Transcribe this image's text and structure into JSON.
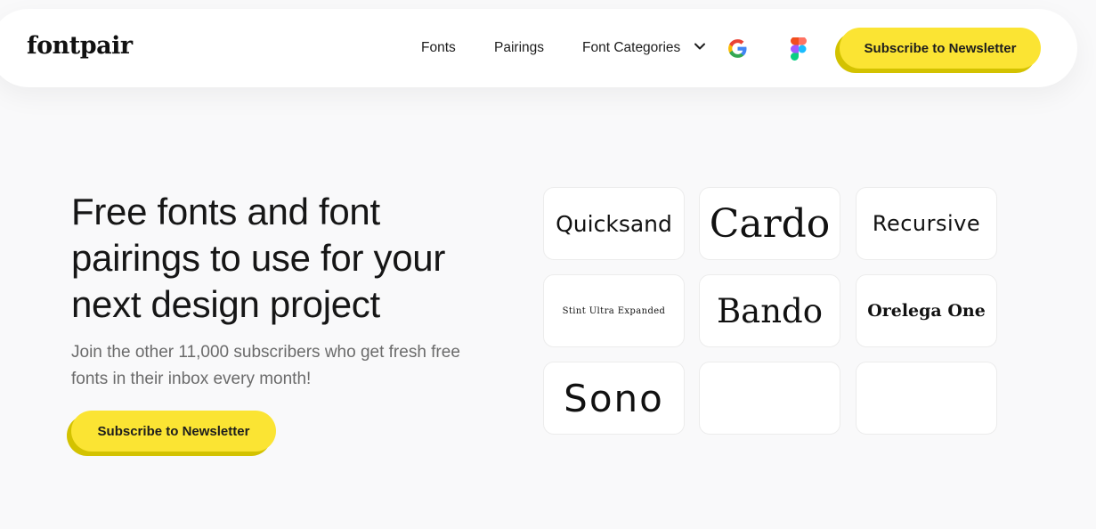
{
  "header": {
    "logo": "fontpair",
    "nav": [
      {
        "label": "Fonts"
      },
      {
        "label": "Pairings"
      },
      {
        "label": "Font Categories"
      }
    ],
    "icons": [
      "chevron-down-icon",
      "google-icon",
      "figma-icon"
    ],
    "cta_label": "Subscribe to Newsletter"
  },
  "hero": {
    "title": "Free fonts and font pairings to use for your next design project",
    "subtitle": "Join the other 11,000 subscribers who get fresh free fonts in their inbox every month!",
    "cta_label": "Subscribe to Newsletter"
  },
  "font_cards": [
    {
      "name": "Quicksand"
    },
    {
      "name": "Cardo"
    },
    {
      "name": "Recursive"
    },
    {
      "name": "Stint Ultra Expanded"
    },
    {
      "name": "Bando"
    },
    {
      "name": "Orelega One"
    },
    {
      "name": "Sono"
    },
    {
      "name": ""
    },
    {
      "name": ""
    }
  ],
  "colors": {
    "accent": "#fbe433",
    "accent_shadow": "#d3c200",
    "background": "#f9f9fa",
    "text": "#161616",
    "muted_text": "#6b6b6b"
  }
}
